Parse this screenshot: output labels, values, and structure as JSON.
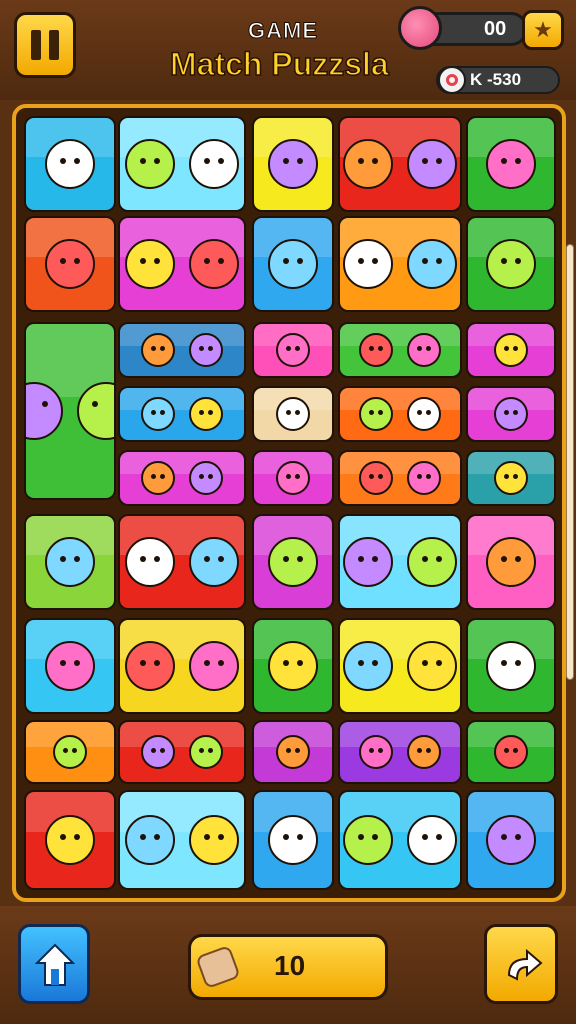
{
  "header": {
    "title_small": "GAME",
    "title_big": "Match Puzzsla",
    "score": "00",
    "level": "K -530"
  },
  "icons": {
    "pause": "pause-icon",
    "candy": "candy-icon",
    "star": "star-icon",
    "level": "target-icon",
    "home": "home-icon",
    "moves": "bandage-icon",
    "next": "arrow-right-icon"
  },
  "footer": {
    "moves": "10"
  },
  "board": {
    "tiles": [
      {
        "color": "#27b8ea",
        "icon": "bear-face-icon",
        "count": 1
      },
      {
        "color": "#7ee6ff",
        "icon": "party-face-cupcake-icon",
        "count": 2
      },
      {
        "color": "#f6ea1e",
        "icon": "pink-bell-icon",
        "count": 1
      },
      {
        "color": "#e8261c",
        "icon": "bottle-blue-monster-icon",
        "count": 2
      },
      {
        "color": "#2fb82f",
        "icon": "girl-face-icon",
        "count": 1
      },
      {
        "color": "#f0541a",
        "icon": "potted-plant-icon",
        "count": 1
      },
      {
        "color": "#e63fd6",
        "icon": "target-lipstick-icon",
        "count": 2
      },
      {
        "color": "#2fa8ef",
        "icon": "crayon-icon",
        "count": 1
      },
      {
        "color": "#ff9a12",
        "icon": "balloon-tree-icon",
        "count": 2
      },
      {
        "color": "#2fb82f",
        "icon": "pumpkin-icon",
        "count": 1
      },
      {
        "color": "#3fbf38",
        "icon": "tree-cat-icon",
        "count": 2
      },
      {
        "color": "#2c86c8",
        "icon": "star-blob-icon",
        "count": 2
      },
      {
        "color": "#ff4fb8",
        "icon": "lightning-icon",
        "count": 1
      },
      {
        "color": "#43c43a",
        "icon": "fruit-faces-icon",
        "count": 2
      },
      {
        "color": "#e63fd6",
        "icon": "pen-icon",
        "count": 1
      },
      {
        "color": "#2aa6ea",
        "icon": "bird-cloud-icon",
        "count": 2
      },
      {
        "color": "#f2d8a6",
        "icon": "lemon-face-icon",
        "count": 1
      },
      {
        "color": "#ff6a12",
        "icon": "heart-leaf-icon",
        "count": 2
      },
      {
        "color": "#e63fd6",
        "icon": "car-icon",
        "count": 1
      },
      {
        "color": "#e63fd6",
        "icon": "apple-icon",
        "count": 2
      },
      {
        "color": "#e63fd6",
        "icon": "cheese-icon",
        "count": 1
      },
      {
        "color": "#ff7a18",
        "icon": "robot-tomato-icon",
        "count": 2
      },
      {
        "color": "#2aa1a9",
        "icon": "potato-icon",
        "count": 1
      },
      {
        "color": "#8ad53a",
        "icon": "green-shape-icon",
        "count": 1
      },
      {
        "color": "#e8261c",
        "icon": "gnome-faces-icon",
        "count": 2
      },
      {
        "color": "#d93fd6",
        "icon": "gift-box-icon",
        "count": 1
      },
      {
        "color": "#6fe0ff",
        "icon": "bottle-rocket-icon",
        "count": 2
      },
      {
        "color": "#ff5fc2",
        "icon": "sun-face-icon",
        "count": 1
      },
      {
        "color": "#35c6f4",
        "icon": "yellow-heart-icon",
        "count": 1
      },
      {
        "color": "#f6d61e",
        "icon": "bunny-bottle-icon",
        "count": 2
      },
      {
        "color": "#2fb82f",
        "icon": "shirt-icon",
        "count": 1
      },
      {
        "color": "#f6ea1e",
        "icon": "heart-dog-icon",
        "count": 2
      },
      {
        "color": "#2fb82f",
        "icon": "mushroom-icon",
        "count": 1
      },
      {
        "color": "#ff8f12",
        "icon": "heart-icon",
        "count": 1
      },
      {
        "color": "#e8261c",
        "icon": "goat-pear-icon",
        "count": 2
      },
      {
        "color": "#c33ad6",
        "icon": "cup-icon",
        "count": 1
      },
      {
        "color": "#9a3ae0",
        "icon": "calendar-heart-icon",
        "count": 2
      },
      {
        "color": "#2fb82f",
        "icon": "tv-icon",
        "count": 1
      },
      {
        "color": "#e8261c",
        "icon": "king-face-icon",
        "count": 1
      },
      {
        "color": "#7ee6ff",
        "icon": "house-balloon-icon",
        "count": 2
      },
      {
        "color": "#2fa8ef",
        "icon": "paintbrush-icon",
        "count": 1
      },
      {
        "color": "#35c6f4",
        "icon": "star-icon",
        "count": 2
      },
      {
        "color": "#2fa8ef",
        "icon": "pretzel-icon",
        "count": 1
      }
    ]
  }
}
